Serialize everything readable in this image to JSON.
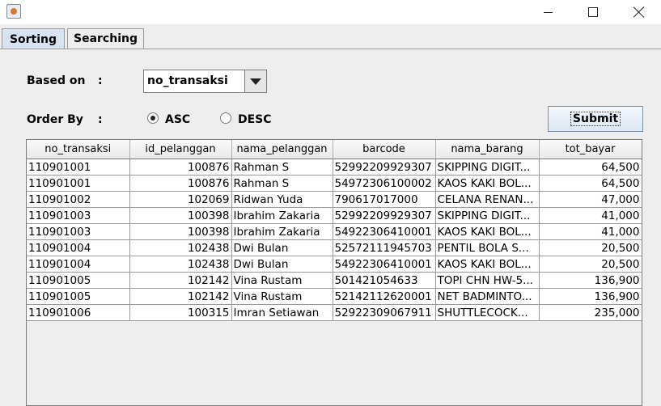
{
  "window": {
    "title": ""
  },
  "tabs": [
    {
      "label": "Sorting",
      "selected": true
    },
    {
      "label": "Searching",
      "selected": false
    }
  ],
  "form": {
    "based_on_label": "Based on",
    "based_on_colon": ":",
    "based_on_value": "no_transaksi",
    "order_by_label": "Order By",
    "order_by_colon": ":",
    "order_options": [
      {
        "label": "ASC",
        "selected": true
      },
      {
        "label": "DESC",
        "selected": false
      }
    ],
    "submit_label": "Submit"
  },
  "table": {
    "columns": [
      "no_transaksi",
      "id_pelanggan",
      "nama_pelanggan",
      "barcode",
      "nama_barang",
      "tot_bayar"
    ],
    "rows": [
      [
        "110901001",
        "100876",
        "Rahman S",
        "52992209929307",
        "SKIPPING DIGIT...",
        "64,500"
      ],
      [
        "110901001",
        "100876",
        "Rahman S",
        "54972306100002",
        "KAOS KAKI BOL...",
        "64,500"
      ],
      [
        "110901002",
        "102069",
        "Ridwan Yuda",
        "790617017000",
        "CELANA RENAN...",
        "47,000"
      ],
      [
        "110901003",
        "100398",
        "Ibrahim Zakaria",
        "52992209929307",
        "SKIPPING DIGIT...",
        "41,000"
      ],
      [
        "110901003",
        "100398",
        "Ibrahim Zakaria",
        "54922306410001",
        "KAOS KAKI BOL...",
        "41,000"
      ],
      [
        "110901004",
        "102438",
        "Dwi Bulan",
        "52572111945703",
        "PENTIL BOLA S...",
        "20,500"
      ],
      [
        "110901004",
        "102438",
        "Dwi Bulan",
        "54922306410001",
        "KAOS KAKI BOL...",
        "20,500"
      ],
      [
        "110901005",
        "102142",
        "Vina Rustam",
        "501421054633",
        "TOPI CHN HW-5...",
        "136,900"
      ],
      [
        "110901005",
        "102142",
        "Vina Rustam",
        "52142112620001",
        "NET BADMINTO...",
        "136,900"
      ],
      [
        "110901006",
        "100315",
        "Imran Setiawan",
        "52922309067911",
        "SHUTTLECOCK...",
        "235,000"
      ]
    ]
  }
}
